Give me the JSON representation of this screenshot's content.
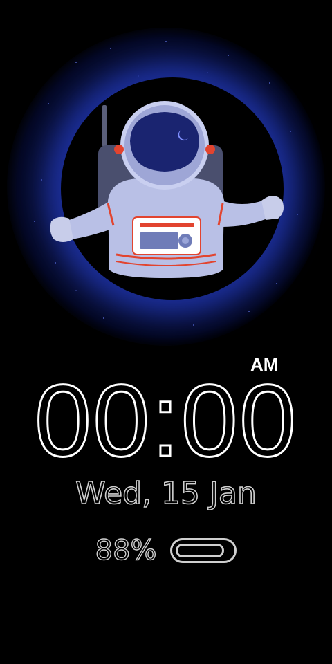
{
  "watchface": {
    "ampm": "AM",
    "time": "00:00",
    "date": "Wed, 15 Jan",
    "battery": {
      "percent_label": "88%",
      "level": 0.88
    }
  },
  "colors": {
    "background": "#000000",
    "glow": "#1c2f9a",
    "text": "#ffffff",
    "suit": "#b9c0e6",
    "accent_red": "#e2442f",
    "visor": "#1a2470"
  },
  "icons": {
    "illustration": "astronaut-illustration",
    "battery": "battery-icon"
  }
}
